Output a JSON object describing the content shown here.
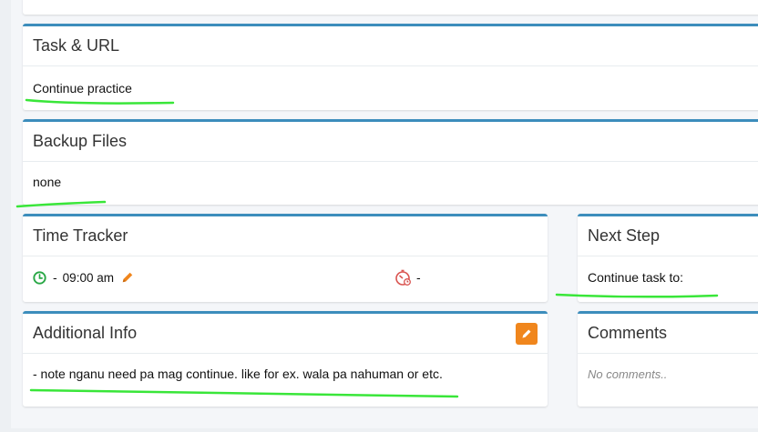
{
  "task_url": {
    "title": "Task & URL",
    "value": "Continue practice"
  },
  "backup_files": {
    "title": "Backup Files",
    "value": "none"
  },
  "time_tracker": {
    "title": "Time Tracker",
    "start_dash": "-",
    "start_time": "09:00 am",
    "end_dash": "-"
  },
  "next_step": {
    "title": "Next Step",
    "value": "Continue task to:"
  },
  "additional_info": {
    "title": "Additional Info",
    "value": "- note nganu need pa mag continue. like for ex. wala pa nahuman or etc."
  },
  "comments": {
    "title": "Comments",
    "value": "No comments.."
  },
  "colors": {
    "card_accent": "#3c8dbc",
    "clock_green": "#28a745",
    "edit_orange": "#f0861d",
    "stopwatch_red": "#d9534f",
    "highlight_green": "#39e639"
  },
  "icons": [
    "clock-icon",
    "pencil-icon",
    "stopwatch-icon",
    "edit-icon"
  ]
}
